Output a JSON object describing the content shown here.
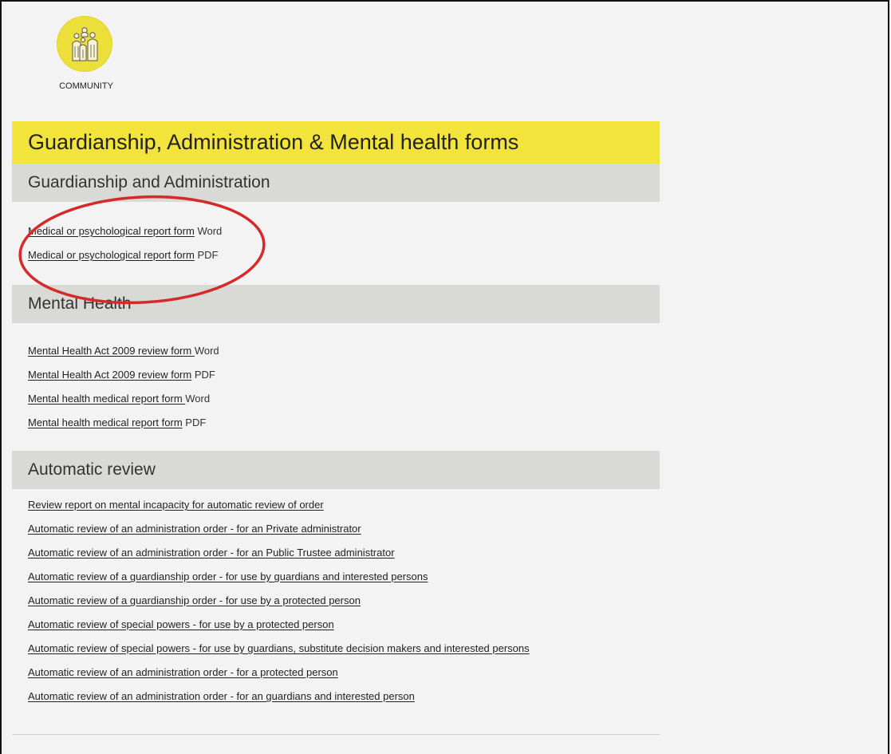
{
  "logo": {
    "label": "COMMUNITY",
    "icon": "people-group-icon",
    "color": "#ecdf3a"
  },
  "page": {
    "title": "Guardianship, Administration & Mental health forms",
    "title_bar_color": "#f2e43b",
    "section_color": "#d9d9d6"
  },
  "sections": [
    {
      "heading": "Guardianship and Administration",
      "links": [
        {
          "text": "Medical or psychological report form",
          "format": "Word"
        },
        {
          "text": "Medical or psychological report form",
          "format": "PDF"
        }
      ]
    },
    {
      "heading": "Mental Health",
      "links": [
        {
          "text": "Mental Health Act 2009 review form ",
          "format": "Word"
        },
        {
          "text": "Mental Health Act 2009 review form",
          "format": "PDF"
        },
        {
          "text": "Mental health medical report form ",
          "format": "Word"
        },
        {
          "text": "Mental health medical report form",
          "format": "PDF"
        }
      ]
    },
    {
      "heading": "Automatic review",
      "links": [
        {
          "text": "Review report on mental incapacity for automatic review of order",
          "format": ""
        },
        {
          "text": "Automatic review of an administration order - for an Private administrator",
          "format": ""
        },
        {
          "text": "Automatic review of an administration order - for an Public Trustee administrator",
          "format": ""
        },
        {
          "text": "Automatic review of a guardianship order - for use by guardians and interested persons",
          "format": ""
        },
        {
          "text": "Automatic review of a guardianship order - for use by a protected person",
          "format": ""
        },
        {
          "text": "Automatic review of special powers - for use by a protected person",
          "format": ""
        },
        {
          "text": "Automatic review of special powers - for use by guardians, substitute decision makers and interested persons",
          "format": ""
        },
        {
          "text": "Automatic review of an administration order - for a protected person",
          "format": ""
        },
        {
          "text": "Automatic review of an administration order - for an guardians and interested person",
          "format": ""
        }
      ]
    }
  ],
  "annotation": {
    "shape": "red-ellipse-highlight",
    "color": "#d42a2a"
  }
}
